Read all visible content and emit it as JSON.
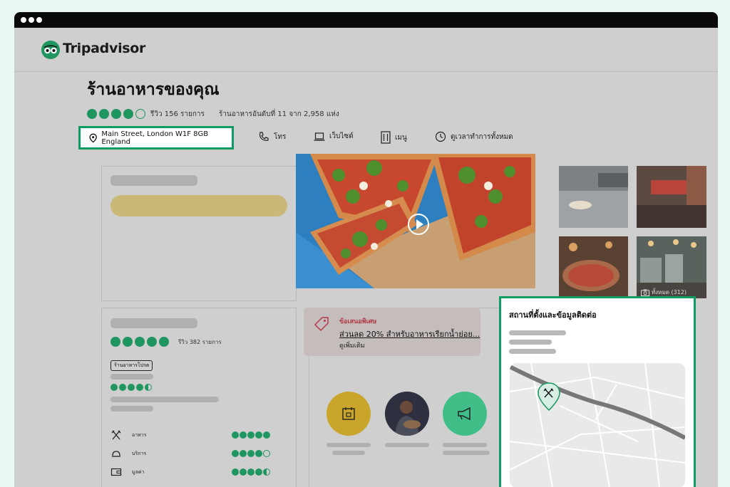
{
  "brand": {
    "name": "Tripadvisor",
    "accent": "#0f9c63",
    "bubble_color": "#1f9560"
  },
  "restaurant": {
    "title": "ร้านอาหารของคุณ",
    "rating": 4,
    "rating_max": 5,
    "reviews_text": "รีวิว 156 รายการ",
    "rank_text": "ร้านอาหารอันดับที่ 11 จาก 2,958 แห่ง"
  },
  "info_bar": {
    "address": "Main Street, London W1F 8GB England",
    "phone": "โทร",
    "website": "เว็บไซต์",
    "menu": "เมนู",
    "hours": "ดูเวลาทำการทั้งหมด"
  },
  "photos": {
    "all_label": "ทั้งหมด (312)"
  },
  "ratings_panel": {
    "overall_rating": 5,
    "reviews_text": "รีวิว 382 รายการ",
    "badge": "ร้านอาหารโปรด",
    "sub_rating": 4.5,
    "categories": [
      {
        "label": "อาหาร",
        "icon": "fork-knife-icon",
        "rating": 5
      },
      {
        "label": "บริการ",
        "icon": "service-bell-icon",
        "rating": 4
      },
      {
        "label": "มูลค่า",
        "icon": "wallet-icon",
        "rating": 4.5
      }
    ]
  },
  "offer": {
    "title": "ข้อเสนอพิเศษ",
    "link": "ส่วนลด 20% สำหรับอาหารเรียกน้ำย่อย...",
    "more": "ดูเพิ่มเติม"
  },
  "contact": {
    "title": "สถานที่ตั้งและข้อมูลติดต่อ"
  }
}
